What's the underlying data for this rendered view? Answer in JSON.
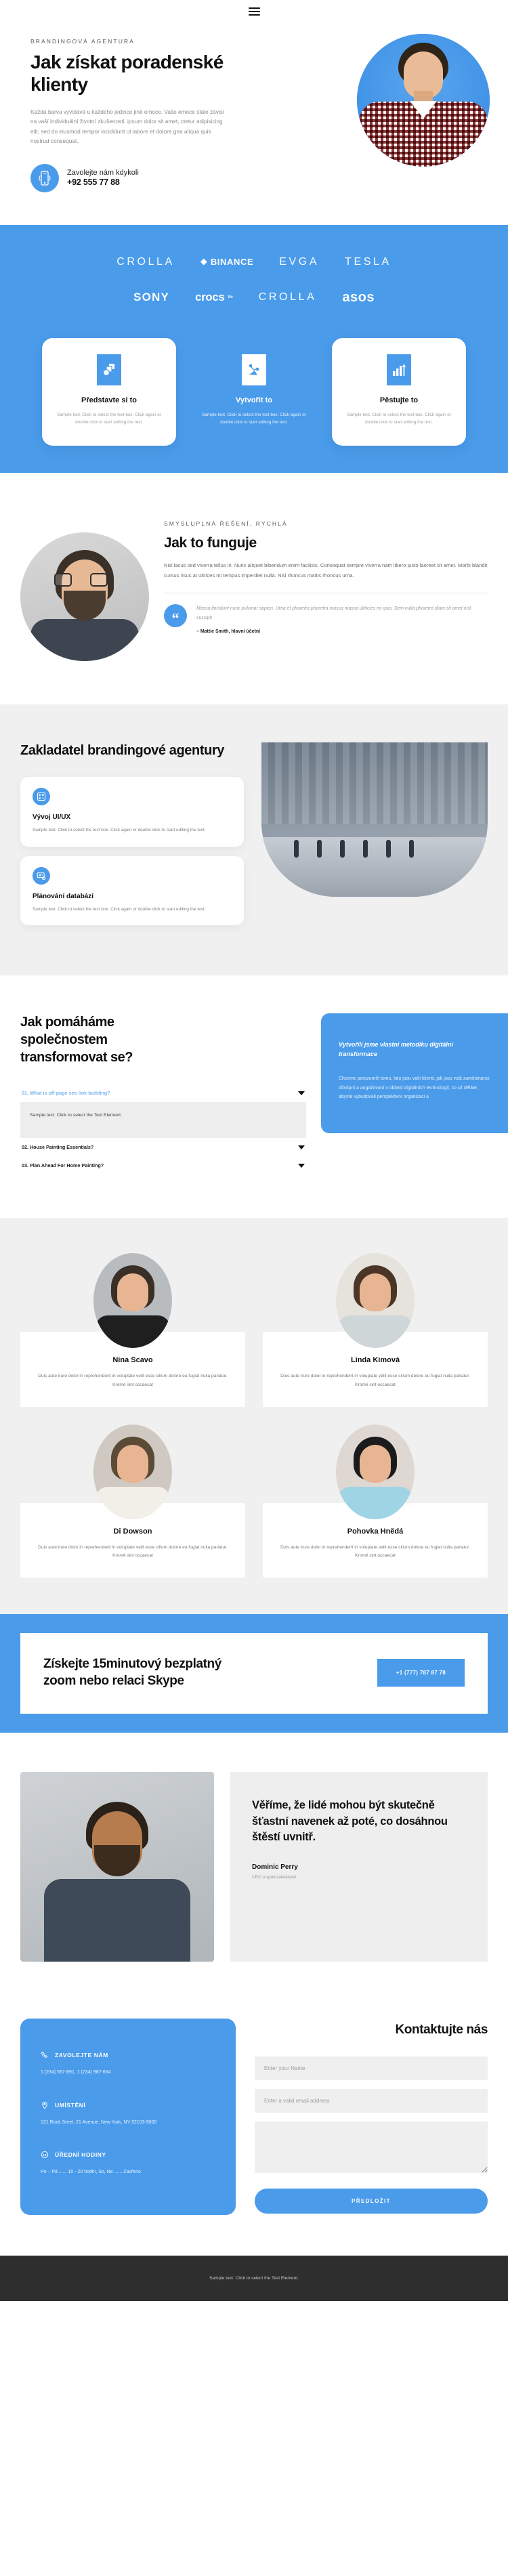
{
  "nav": {
    "menu_label": "Menu"
  },
  "hero": {
    "eyebrow": "BRANDINGOVÁ AGENTURA",
    "title": "Jak získat poradenské klienty",
    "lead": "Každá barva vyvolává u každého jedince jiné emoce. Vaše emoce stále závisí na vaší individuální životní zkušenosti. ipsum dolor sit amet, ctetur adipisicing elit, sed do eiusmod tempor incididunt ut labore et dolore gna aliqua quis nostrud consequat.",
    "call_label": "Zavolejte nám kdykoli",
    "call_number": "+92 555 77 88"
  },
  "logos": {
    "row1": [
      {
        "name": "CROLLA",
        "style": "thin"
      },
      {
        "name": "BINANCE",
        "style": "bold",
        "icon": "diamond-icon"
      },
      {
        "name": "EVGA",
        "style": "thin"
      },
      {
        "name": "TESLA",
        "style": "thin"
      }
    ],
    "row2": [
      {
        "name": "SONY",
        "style": "sony"
      },
      {
        "name": "crocs",
        "style": "crocs",
        "sup": "tm"
      },
      {
        "name": "CROLLA",
        "style": "thin"
      },
      {
        "name": "asos",
        "style": "asos"
      }
    ]
  },
  "features": [
    {
      "title": "Představte si to",
      "text": "Sample text. Click to select the text box. Click again or double click to start editing the text.",
      "icon": "shapes-icon",
      "variant": "white"
    },
    {
      "title": "Vytvořit to",
      "text": "Sample text. Click to select the text box. Click again or double click to start editing the text.",
      "icon": "nodes-icon",
      "variant": "plain"
    },
    {
      "title": "Pěstujte to",
      "text": "Sample text. Click to select the text box. Click again or double click to start editing the text.",
      "icon": "growth-chart-icon",
      "variant": "white"
    }
  ],
  "howworks": {
    "eyebrow": "SMYSLUPLNÁ ŘEŠENÍ, RYCHLÁ",
    "title": "Jak to funguje",
    "body": "Nisi lacus sed viverra tellus in. Nunc aliquet bibendum enim facilisis. Consequat sempre viverra nam libero justo laoreet sit amet. Morbi blandit cursus risus at ultrices mi tempus imperdiet nulla. Nisl rhoncus mattis rhoncus urna.",
    "quote": "Massa tincidunt nunc pulvinar sapien. Urna et pharetra pharetra massa massa ultricies mi quis. Sem nulla pharetra diam sit amet nisl suscipit",
    "quote_author": "– Mattie Smith, hlavní účetní"
  },
  "founder": {
    "title": "Zakladatel brandingové agentury",
    "cards": [
      {
        "title": "Vývoj UI/UX",
        "text": "Sample text. Click to select the text box. Click again or double click to start editing the text.",
        "icon": "qr-code-icon"
      },
      {
        "title": "Plánování databází",
        "text": "Sample text. Click to select the text box. Click again or double click to start editing the text.",
        "icon": "database-screen-icon"
      }
    ]
  },
  "faq": {
    "title": "Jak pomáháme společnostem transformovat se?",
    "items": [
      {
        "label": "01. What is off page seo link building?",
        "open": true,
        "body": "Sample text. Click to select the Text Element."
      },
      {
        "label": "02. House Painting Essentials?",
        "open": false,
        "body": ""
      },
      {
        "label": "03. Plan Ahead For Home Painting?",
        "open": false,
        "body": ""
      }
    ],
    "panel_title": "Vytvořili jsme vlastní metodiku digitální transformace",
    "panel_text": "Chceme porozumět tomu, kdo jsou vaši klienti, jak jsou vaši zaměstnanci důvtipní a angažovaní v oblasti digitálních technologií, co už děláte, abyste vybudovali perspektivní organizaci a"
  },
  "team": [
    {
      "name": "Nina Scavo",
      "text": "Duis aute irure dolor in reprehenderit in voluptate velit esse cillum dolore eu fugiat nulla pariatur. Kromě sint occaecat",
      "hair": "#3a2f26",
      "body": "#1f1f1f",
      "bg": "#b9bcbe"
    },
    {
      "name": "Linda Kimová",
      "text": "Duis aute irure dolor in reprehenderit in voluptate velit esse cillum dolore eu fugiat nulla pariatur. Kromě sint occaecat",
      "hair": "#4a3526",
      "body": "#cfd6d8",
      "bg": "#e6e2dc"
    },
    {
      "name": "Di Dowson",
      "text": "Duis aute irure dolor in reprehenderit in voluptate velit esse cillum dolore eu fugiat nulla pariatur. Kromě sint occaecat",
      "hair": "#5b4a36",
      "body": "#f2efe9",
      "bg": "#cfc9c1"
    },
    {
      "name": "Pohovka Hnědá",
      "text": "Duis aute irure dolor in reprehenderit in voluptate velit esse cillum dolore eu fugiat nulla pariatur. Kromě sint occaecat",
      "hair": "#1b1b1d",
      "body": "#9fd4e4",
      "bg": "#dfd7d2"
    }
  ],
  "cta": {
    "title": "Získejte 15minutový bezplatný zoom nebo relaci Skype",
    "button": "+1 (777) 787 87 78"
  },
  "testimonial": {
    "quote": "Věříme, že lidé mohou být skutečně šťastní navenek až poté, co dosáhnou štěstí uvnitř.",
    "name": "Dominic Perry",
    "role": "CEO a spoluzakladatel"
  },
  "contact": {
    "blocks": [
      {
        "icon": "phone-icon",
        "title": "ZAVOLEJTE NÁM",
        "value": "1 (234) 567-891, 1 (234) 987-654"
      },
      {
        "icon": "location-pin-icon",
        "title": "UMÍSTĚNÍ",
        "value": "121 Rock Sreet, 21 Avenue, New York, NY 92103-9000"
      },
      {
        "icon": "clock-24-icon",
        "title": "ÚŘEDNÍ HODINY",
        "value": "Po – Pá ...... 10 - 20 hodin, So, Ne ...... Zavřeno"
      }
    ],
    "form_title": "Kontaktujte nás",
    "name_placeholder": "Enter your Name",
    "email_placeholder": "Enter a valid email address",
    "message_placeholder": "",
    "submit_label": "PŘEDLOŽIT"
  },
  "footer": {
    "text": "Sample text. Click to select the Text Element."
  },
  "colors": {
    "accent": "#4a9bea",
    "dark": "#2e2e2e",
    "gray": "#f0f0f0"
  }
}
